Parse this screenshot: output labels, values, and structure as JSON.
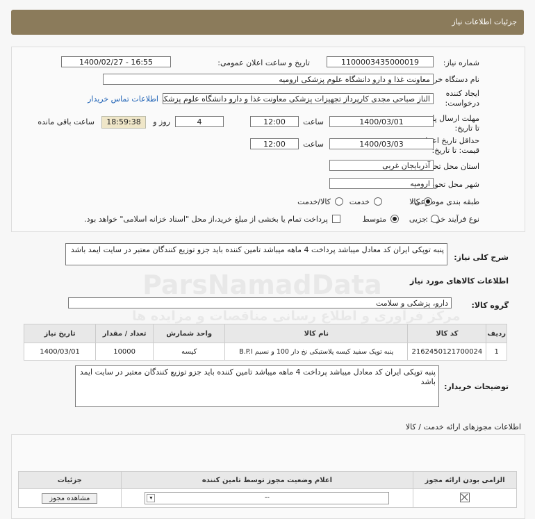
{
  "header": {
    "title": "جزئیات اطلاعات نیاز"
  },
  "form": {
    "need_number_label": "شماره نیاز:",
    "need_number": "1100003435000019",
    "announce_label": "تاریخ و ساعت اعلان عمومی:",
    "announce_value": "1400/02/27 - 16:55",
    "buyer_label": "نام دستگاه خریدار:",
    "buyer_value": "معاونت غذا و دارو دانشگاه علوم پزشکی ارومیه",
    "creator_label_1": "ایجاد کننده",
    "creator_label_2": "درخواست:",
    "creator_value": "الناز صباحی مجدی کارپرداز تجهیزات پزشکی معاونت غذا و دارو دانشگاه علوم پزشکی",
    "contact_link": "اطلاعات تماس خریدار",
    "deadline_label_1": "مهلت ارسال پاسخ:",
    "deadline_label_2": "تا تاریخ:",
    "deadline_date": "1400/03/01",
    "time_label": "ساعت",
    "deadline_time": "12:00",
    "days_value": "4",
    "days_label": "روز و",
    "remaining_time": "18:59:38",
    "remaining_label": "ساعت باقی مانده",
    "validity_label_1": "حداقل تاریخ اعتبار",
    "validity_label_2": "قیمت: تا تاریخ:",
    "validity_date": "1400/03/03",
    "validity_time": "12:00",
    "province_label": "استان محل تحویل:",
    "province_value": "آذربایجان غربی",
    "city_label": "شهر محل تحویل:",
    "city_value": "ارومیه",
    "category_label": "طبقه بندی موضوعی:",
    "category_options": [
      "کالا",
      "خدمت",
      "کالا/خدمت"
    ],
    "process_label": "نوع فرآیند خرید :",
    "process_options": [
      "جزیی",
      "متوسط"
    ],
    "payment_note": "پرداخت تمام یا بخشی از مبلغ خرید،از محل \"اسناد خزانه اسلامی\" خواهد بود."
  },
  "summary": {
    "label": "شرح کلی نیاز:",
    "text": "پنبه توپکی ایران کد معادل میباشد پرداخت 4 ماهه میباشد تامین کننده باید جزو توزیع کنندگان معتبر در سایت ایمد باشد"
  },
  "goods": {
    "section_title": "اطلاعات کالاهای مورد نیاز",
    "group_label": "گروه کالا:",
    "group_value": "دارو، پزشکی و سلامت",
    "columns": [
      "ردیف",
      "کد کالا",
      "نام کالا",
      "واحد شمارش",
      "تعداد / مقدار",
      "تاریخ نیاز"
    ],
    "rows": [
      {
        "idx": "1",
        "code": "2162450121700024",
        "name": "پنبه توپک سفید کیسه پلاستیکی نخ دار 100 و نسیم B.P.I",
        "unit": "کیسه",
        "qty": "10000",
        "date": "1400/03/01"
      }
    ],
    "buyer_notes_label": "توضیحات خریدار:",
    "buyer_notes": "پنبه توپکی ایران کد معادل میباشد پرداخت 4 ماهه میباشد تامین کننده باید جزو توزیع کنندگان معتبر در سایت ایمد باشد"
  },
  "permits": {
    "section_title": "اطلاعات مجوزهای ارائه خدمت / کالا",
    "columns": [
      "الزامی بودن ارائه مجوز",
      "اعلام وضعیت مجوز توسط تامین کننده",
      "جزئیات"
    ],
    "select_value": "--",
    "view_button": "مشاهده مجوز"
  },
  "watermark": {
    "brand": "ParsNamadData",
    "tagline": "مرکز فرآوری و اطلاع رسانی مناقصات و مزایده ها"
  }
}
